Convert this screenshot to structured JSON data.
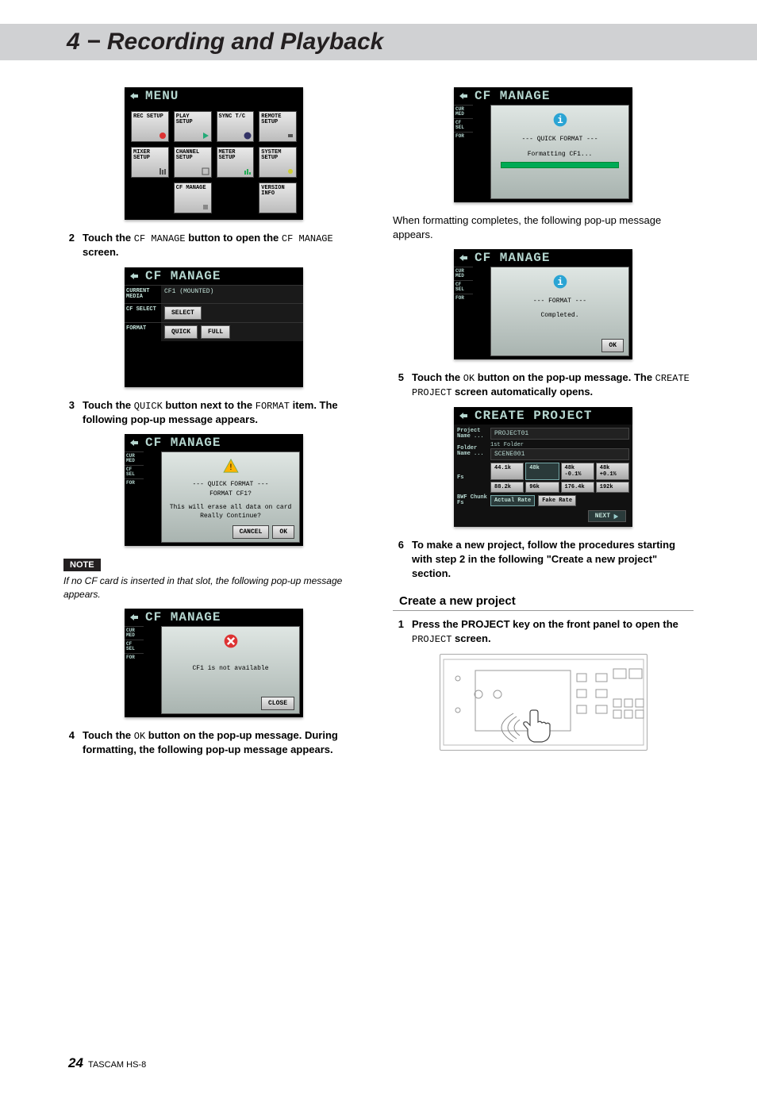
{
  "header": {
    "title": "4 − Recording and Playback"
  },
  "footer": {
    "page": "24",
    "model": "TASCAM  HS-8"
  },
  "left": {
    "menu": {
      "title": "MENU",
      "items": [
        "REC SETUP",
        "PLAY SETUP",
        "SYNC T/C",
        "REMOTE SETUP",
        "MIXER SETUP",
        "CHANNEL SETUP",
        "METER SETUP",
        "SYSTEM SETUP",
        "",
        "CF MANAGE",
        "",
        "VERSION INFO"
      ]
    },
    "step2": {
      "num": "2",
      "t1": "Touch the ",
      "code1": "CF MANAGE",
      "t2": " button to open the ",
      "code2": "CF MANAGE",
      "t3": " screen."
    },
    "cfmanage_title": "CF MANAGE",
    "cf": {
      "row1_lab": "CURRENT MEDIA",
      "row1_val": "CF1 (MOUNTED)",
      "row2_lab": "CF SELECT",
      "row2_btn": "SELECT",
      "row3_lab": "FORMAT",
      "row3_b1": "QUICK",
      "row3_b2": "FULL"
    },
    "step3": {
      "num": "3",
      "t1": "Touch the ",
      "code1": "QUICK",
      "t2": " button next to the ",
      "code2": "FORMAT",
      "t3": " item. The following pop-up message appears."
    },
    "popup_quick": {
      "l1": "--- QUICK FORMAT ---",
      "l2": "FORMAT CF1?",
      "l3": "This will erase all data on card",
      "l4": "Really Continue?",
      "cancel": "CANCEL",
      "ok": "OK"
    },
    "note_label": "NOTE",
    "note_text": "If no CF card is inserted in that slot, the following pop-up message appears.",
    "popup_na": {
      "l1": "CF1 is not available",
      "close": "CLOSE"
    },
    "step4": {
      "num": "4",
      "t1": "Touch the ",
      "code1": "OK",
      "t2": " button on the pop-up message. During formatting, the following pop-up message appears."
    }
  },
  "right": {
    "popup_formatting": {
      "l1": "--- QUICK FORMAT ---",
      "l2": "Formatting CF1..."
    },
    "after_format": "When formatting completes, the following pop-up message appears.",
    "popup_done": {
      "l1": "--- FORMAT ---",
      "l2": "Completed.",
      "ok": "OK"
    },
    "step5": {
      "num": "5",
      "t1": "Touch the ",
      "code1": "OK",
      "t2": " button on the pop-up message. The ",
      "code2": "CREATE PROJECT",
      "t3": " screen automatically opens."
    },
    "create_title": "CREATE PROJECT",
    "cp": {
      "proj_lab": "Project Name ...",
      "proj_val": "PROJECT01",
      "fold_lab": "Folder Name ...",
      "fold_l1": "1st Folder",
      "fold_val": "SCENE001",
      "fs_lab": "Fs",
      "fs_opts": [
        "44.1k",
        "48k",
        "48k -0.1%",
        "48k +0.1%",
        "88.2k",
        "96k",
        "176.4k",
        "192k"
      ],
      "bwf_lab": "BWF Chunk Fs",
      "bwf_o1": "Actual Rate",
      "bwf_o2": "Fake Rate",
      "next": "NEXT"
    },
    "step6": {
      "num": "6",
      "text": "To make a new project, follow the procedures starting with step 2 in the following \"Create a new project\" section."
    },
    "subhead": "Create a new project",
    "step1b": {
      "num": "1",
      "t1": "Press the ",
      "b1": "PROJECT",
      "t2": " key on the front panel to open the ",
      "code1": "PROJECT",
      "t3": " screen."
    },
    "side": {
      "a": "CUR MED",
      "b": "CF SEL",
      "c": "FOR"
    }
  }
}
